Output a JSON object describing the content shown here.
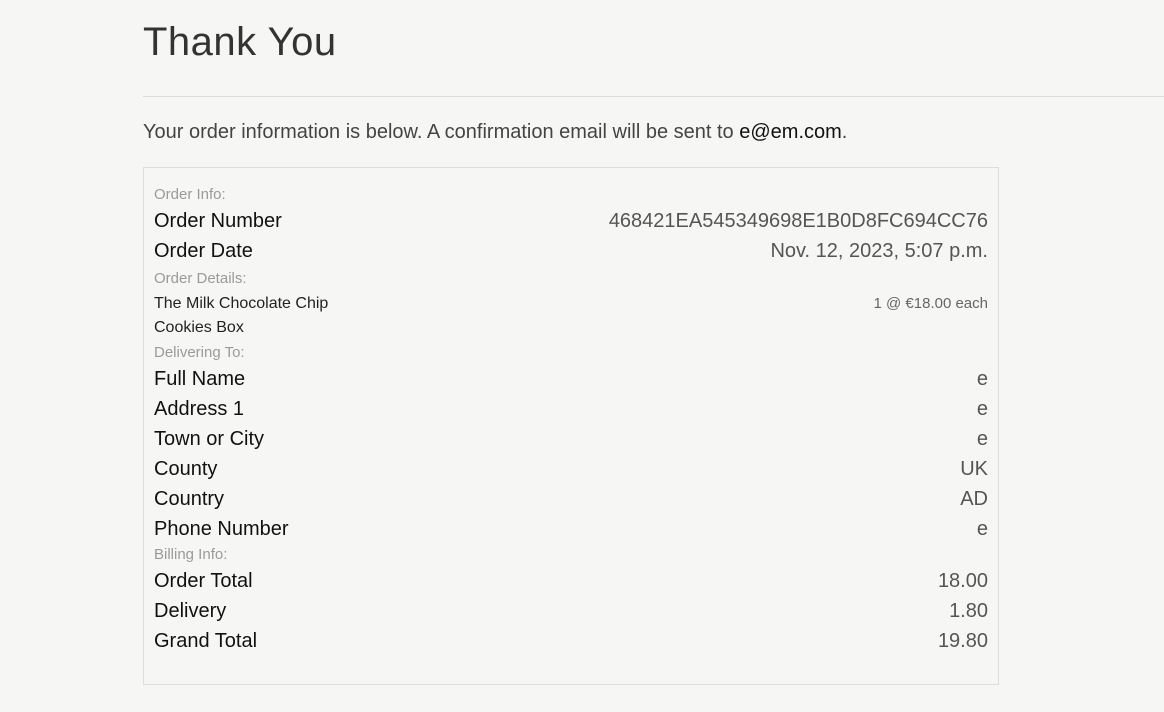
{
  "page": {
    "title": "Thank You",
    "intro_prefix": "Your order information is below. A confirmation email will be sent to ",
    "intro_email": "e@em.com",
    "intro_suffix": "."
  },
  "order_info": {
    "section_label": "Order Info:",
    "rows": [
      {
        "label": "Order Number",
        "value": "468421EA545349698E1B0D8FC694CC76"
      },
      {
        "label": "Order Date",
        "value": "Nov. 12, 2023, 5:07 p.m."
      }
    ]
  },
  "order_details": {
    "section_label": "Order Details:",
    "items": [
      {
        "name": "The Milk Chocolate Chip Cookies Box",
        "qty_price": "1 @ €18.00 each"
      }
    ]
  },
  "delivering_to": {
    "section_label": "Delivering To:",
    "rows": [
      {
        "label": "Full Name",
        "value": "e"
      },
      {
        "label": "Address 1",
        "value": "e"
      },
      {
        "label": "Town or City",
        "value": "e"
      },
      {
        "label": "County",
        "value": "UK"
      },
      {
        "label": "Country",
        "value": "AD"
      },
      {
        "label": "Phone Number",
        "value": "e"
      }
    ]
  },
  "billing_info": {
    "section_label": "Billing Info:",
    "rows": [
      {
        "label": "Order Total",
        "value": "18.00"
      },
      {
        "label": "Delivery",
        "value": "1.80"
      },
      {
        "label": "Grand Total",
        "value": "19.80"
      }
    ]
  }
}
